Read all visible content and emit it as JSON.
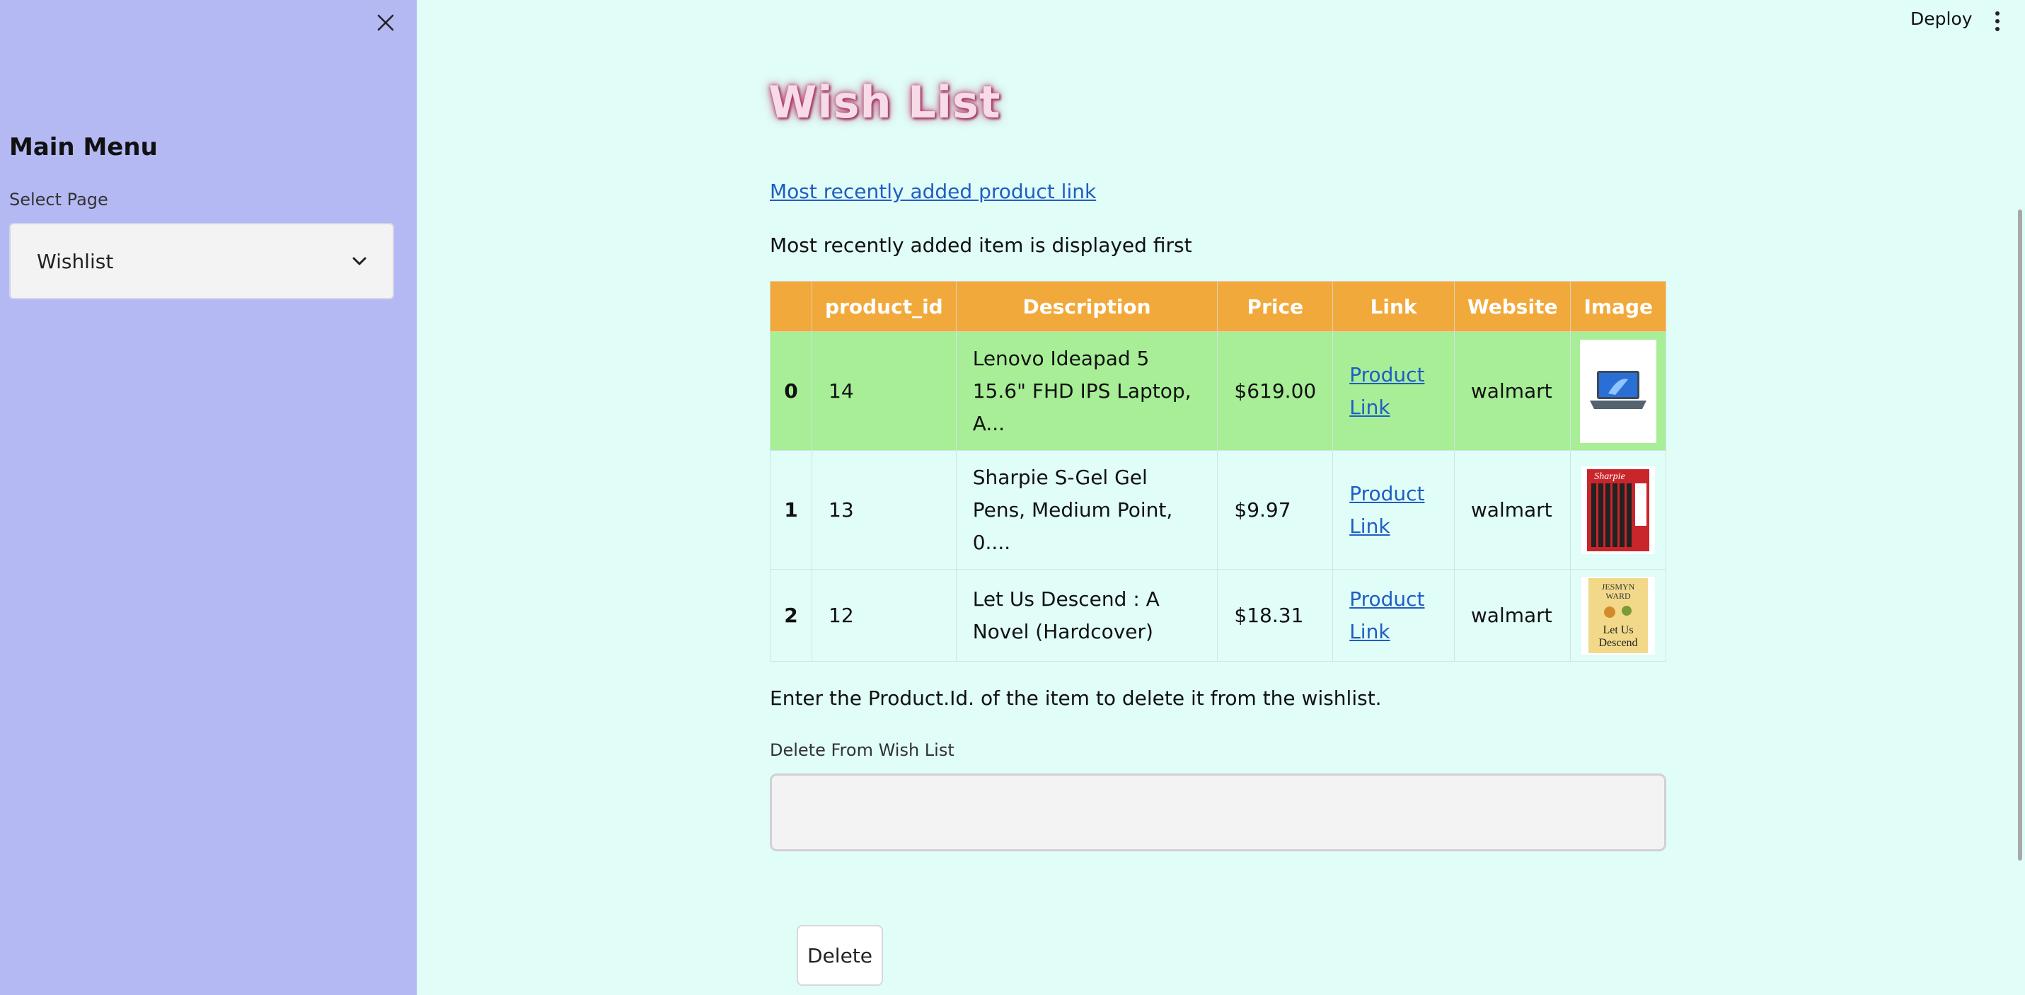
{
  "sidebar": {
    "title": "Main Menu",
    "select_label": "Select Page",
    "select_value": "Wishlist"
  },
  "header": {
    "deploy_label": "Deploy"
  },
  "main": {
    "title": "Wish List",
    "recent_link": "Most recently added product link",
    "recent_note": "Most recently added item is displayed first",
    "table": {
      "headers": [
        "",
        "product_id",
        "Description",
        "Price",
        "Link",
        "Website",
        "Image"
      ],
      "rows": [
        {
          "index": "0",
          "product_id": "14",
          "description": "Lenovo Ideapad 5 15.6\" FHD IPS Laptop, A...",
          "price": "$619.00",
          "link": "Product Link",
          "website": "walmart",
          "image": "laptop-image"
        },
        {
          "index": "1",
          "product_id": "13",
          "description": "Sharpie S-Gel Gel Pens, Medium Point, 0....",
          "price": "$9.97",
          "link": "Product Link",
          "website": "walmart",
          "image": "pens-image"
        },
        {
          "index": "2",
          "product_id": "12",
          "description": "Let Us Descend : A Novel (Hardcover)",
          "price": "$18.31",
          "link": "Product Link",
          "website": "walmart",
          "image": "book-image"
        }
      ]
    },
    "delete_note": "Enter the Product.Id. of the item to delete it from the wishlist.",
    "delete_label": "Delete From Wish List",
    "delete_value": "",
    "delete_button": "Delete",
    "book_cover": {
      "line1": "JESMYN",
      "line2": "WARD",
      "line3": "Let Us",
      "line4": "Descend"
    },
    "pens_brand": "Sharpie"
  },
  "colors": {
    "sidebar_bg": "#b5b9f3",
    "main_bg": "#e0fdf8",
    "table_header": "#f2a93b",
    "highlight_row": "#a7ee97",
    "link": "#1f5ec2"
  }
}
